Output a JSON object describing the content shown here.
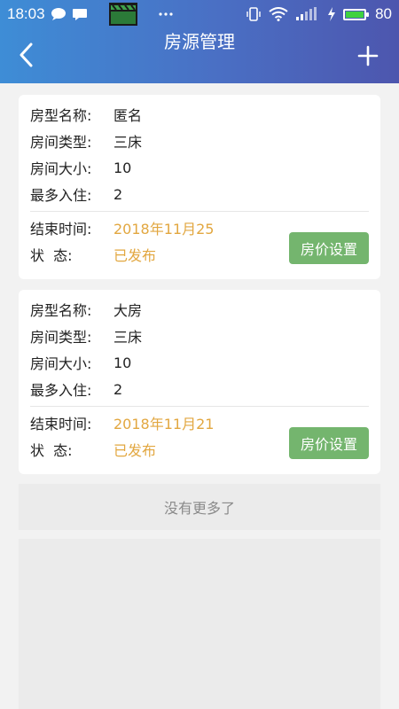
{
  "status_bar": {
    "time": "18:03",
    "battery": "80",
    "icons": [
      "chat-bubble-icon",
      "message-icon",
      "clapperboard-icon",
      "more-dots-icon",
      "vibrate-icon",
      "wifi-icon",
      "signal-icon",
      "charging-icon",
      "battery-icon"
    ]
  },
  "header": {
    "title": "房源管理",
    "back_icon": "chevron-left-icon",
    "add_icon": "plus-icon",
    "colors": {
      "start": "#3e8dd6",
      "end": "#4d56ae"
    }
  },
  "labels": {
    "room_name": "房型名称:",
    "room_type": "房间类型:",
    "room_size": "房间大小:",
    "max_guests": "最多入住:",
    "end_time": "结束时间:",
    "status": "状  态:"
  },
  "listings": [
    {
      "name": "匿名",
      "type": "三床",
      "size": "10",
      "max_guests": "2",
      "end_time": "2018年11月25",
      "status": "已发布",
      "button": "房价设置"
    },
    {
      "name": "大房",
      "type": "三床",
      "size": "10",
      "max_guests": "2",
      "end_time": "2018年11月21",
      "status": "已发布",
      "button": "房价设置"
    }
  ],
  "footer": {
    "no_more": "没有更多了"
  },
  "colors": {
    "accent_orange": "#e2a740",
    "button_green": "#74b56e"
  }
}
